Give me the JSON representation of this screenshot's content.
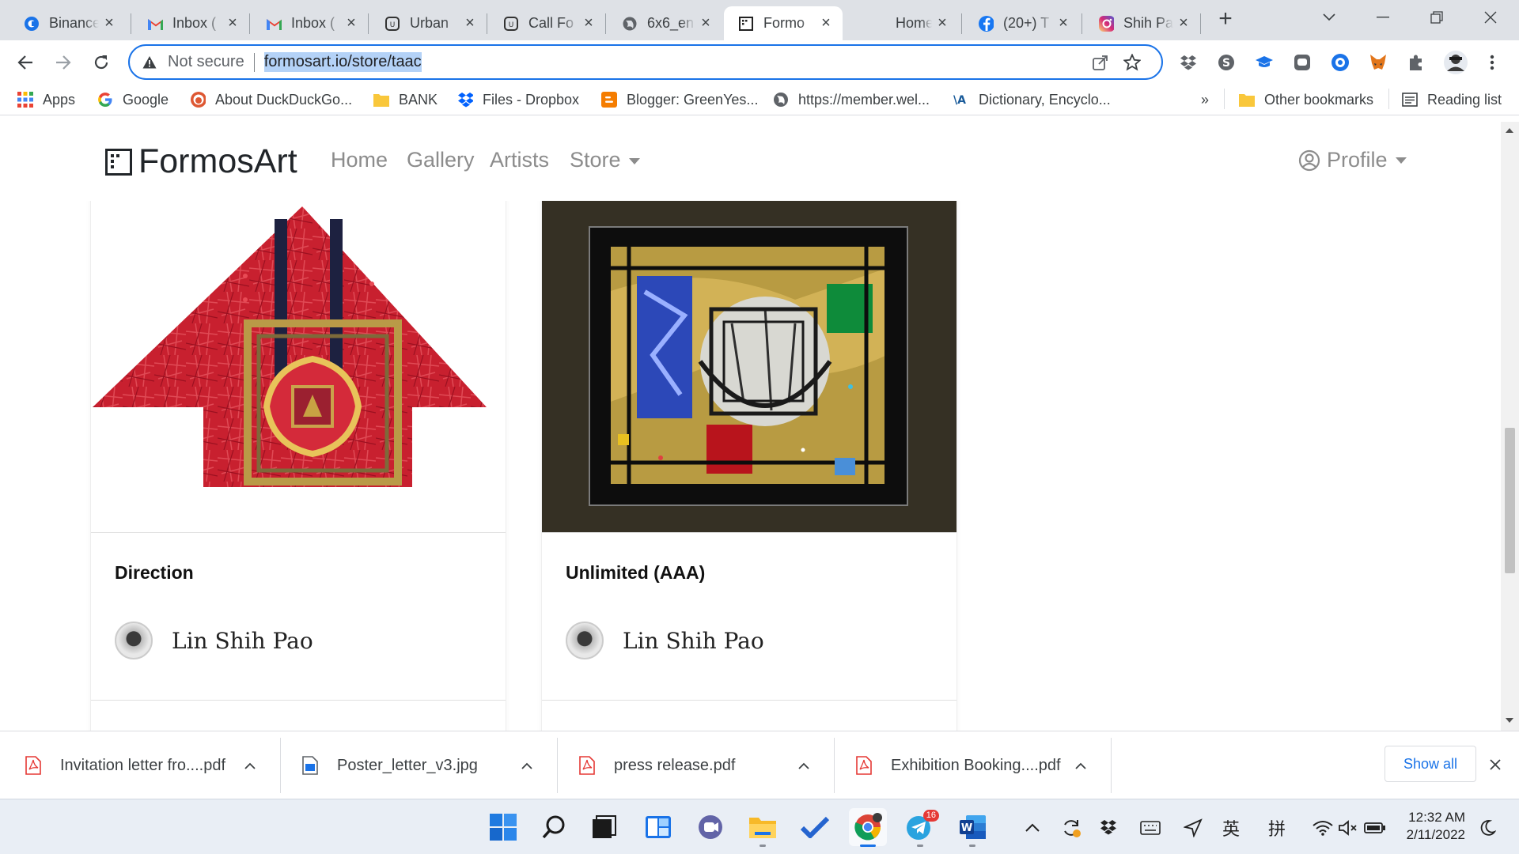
{
  "browser": {
    "tabs": [
      {
        "title": "Binance",
        "icon": "binance-icon"
      },
      {
        "title": "Inbox (",
        "icon": "gmail-icon"
      },
      {
        "title": "Inbox (",
        "icon": "gmail-icon"
      },
      {
        "title": "Urban",
        "icon": "urban-icon"
      },
      {
        "title": "Call Fo",
        "icon": "urban-icon"
      },
      {
        "title": "6x6_en",
        "icon": "globe-icon"
      },
      {
        "title": "Formo",
        "icon": "formosart-icon",
        "active": true
      },
      {
        "title": "Home",
        "icon": "blank-icon"
      },
      {
        "title": "(20+) T",
        "icon": "facebook-icon"
      },
      {
        "title": "Shih Pa",
        "icon": "instagram-icon"
      }
    ],
    "address": {
      "security_label": "Not secure",
      "url": "formosart.io/store/taac"
    },
    "bookmarks": [
      {
        "label": "Apps",
        "icon": "apps-grid-icon"
      },
      {
        "label": "Google",
        "icon": "google-icon"
      },
      {
        "label": "About DuckDuckGo...",
        "icon": "duckduckgo-icon"
      },
      {
        "label": "BANK",
        "icon": "folder-icon"
      },
      {
        "label": "Files - Dropbox",
        "icon": "dropbox-icon"
      },
      {
        "label": "Blogger: GreenYes...",
        "icon": "blogger-icon"
      },
      {
        "label": "https://member.wel...",
        "icon": "globe-icon"
      },
      {
        "label": "Dictionary, Encyclo...",
        "icon": "dictionary-icon"
      }
    ],
    "bookmarks_overflow": "»",
    "other_bookmarks": "Other bookmarks",
    "reading_list": "Reading list"
  },
  "site": {
    "brand": "FormosArt",
    "nav": [
      "Home",
      "Gallery",
      "Artists",
      "Store"
    ],
    "profile": "Profile",
    "cards": [
      {
        "title": "Direction",
        "artist": "Lin Shih Pao"
      },
      {
        "title": "Unlimited (AAA)",
        "artist": "Lin Shih Pao"
      }
    ]
  },
  "downloads": {
    "items": [
      {
        "name": "Invitation letter fro....pdf",
        "type": "pdf"
      },
      {
        "name": "Poster_letter_v3.jpg",
        "type": "image"
      },
      {
        "name": "press release.pdf",
        "type": "pdf"
      },
      {
        "name": "Exhibition Booking....pdf",
        "type": "pdf"
      }
    ],
    "show_all": "Show all"
  },
  "taskbar": {
    "apps": [
      "windows-start-icon",
      "search-icon",
      "task-view-icon",
      "widgets-icon",
      "teams-chat-icon",
      "file-explorer-icon",
      "todo-icon",
      "chrome-icon",
      "telegram-icon",
      "word-icon"
    ],
    "telegram_badge": "16",
    "ime_label_1": "英",
    "ime_label_2": "拼",
    "time": "12:32 AM",
    "date": "2/11/2022"
  },
  "colors": {
    "accent": "#1a73e8",
    "tabstrip": "#dee1e6",
    "nav_text": "#8c8c8c"
  }
}
